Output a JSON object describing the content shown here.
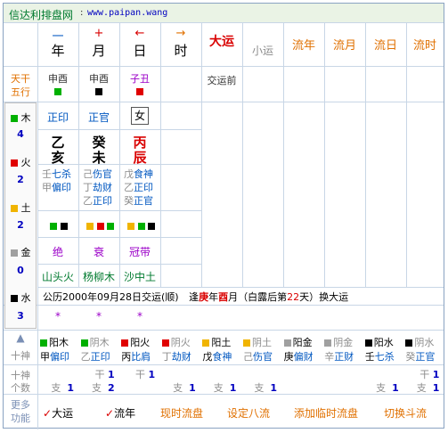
{
  "header": {
    "site_name": "信达利排盘网",
    "site_url": "www.paipan.wang"
  },
  "columns": {
    "year": {
      "top": "一",
      "label": "年"
    },
    "month": {
      "top": "+",
      "label": "月"
    },
    "day": {
      "top": "←",
      "label": "日"
    },
    "hour": {
      "top": "→",
      "label": "时"
    },
    "dayun": "大运",
    "xiaoyun": "小运",
    "liunian": "流年",
    "liuyue": "流月",
    "liuri": "流日",
    "liushi": "流时"
  },
  "left_labels": {
    "tiangan": "天干",
    "wuxing": "五行",
    "shishen": "十神",
    "geshu": "个数",
    "more": "更多",
    "func": "功能"
  },
  "elements": [
    {
      "name": "木",
      "count": "4",
      "color": "#00b000"
    },
    {
      "name": "火",
      "count": "2",
      "color": "#e00000"
    },
    {
      "name": "土",
      "count": "2",
      "color": "#f0b400"
    },
    {
      "name": "金",
      "count": "0",
      "color": "#a0a0a0"
    },
    {
      "name": "水",
      "count": "3",
      "color": "#000000"
    }
  ],
  "pillars": [
    {
      "nayin_top": "申酉",
      "top_color": "#00b000",
      "shishen": "正印",
      "gan": "乙",
      "zhi": "亥",
      "canggan": [
        {
          "gan": "壬",
          "god": "七杀"
        },
        {
          "gan": "甲",
          "god": "偏印"
        }
      ],
      "colors": [
        "#00b000",
        "#000000"
      ],
      "nayin": "山头火",
      "star": "*"
    },
    {
      "nayin_top": "申酉",
      "top_color": "#000000",
      "shishen": "正官",
      "gan": "癸",
      "zhi": "未",
      "canggan": [
        {
          "gan": "己",
          "god": "伤官"
        },
        {
          "gan": "丁",
          "god": "劫财"
        },
        {
          "gan": "乙",
          "god": "正印"
        }
      ],
      "colors": [
        "#f0b400",
        "#e00000",
        "#00b000"
      ],
      "nayin": "杨柳木",
      "star": "*"
    },
    {
      "nayin_top": "子丑",
      "top_color": "#e00000",
      "shishen": "女",
      "gan": "丙",
      "zhi": "辰",
      "canggan": [
        {
          "gan": "戊",
          "god": "食神"
        },
        {
          "gan": "乙",
          "god": "正印"
        },
        {
          "gan": "癸",
          "god": "正官"
        }
      ],
      "colors": [
        "#f0b400",
        "#00b000",
        "#000000"
      ],
      "nayin": "沙中土",
      "star": "*"
    }
  ],
  "changsheng": [
    "绝",
    "衰",
    "冠带"
  ],
  "dayun_note": "交运前",
  "info_line": {
    "prefix": "公历2000年09月28日交运",
    "paren": "(顺)",
    "mid": "逢",
    "gan": "庚",
    "text1": "年",
    "zhi": "酉",
    "text2": "月（白露后第",
    "days": "22",
    "text3": "天）换大运"
  },
  "shishen_row": [
    {
      "sq": "#00b000",
      "gz": "阳木",
      "gan": "甲",
      "god": "偏印",
      "active": true
    },
    {
      "sq": "#00b000",
      "gz": "阴木",
      "gan": "乙",
      "god": "正印",
      "active": false
    },
    {
      "sq": "#e00000",
      "gz": "阳火",
      "gan": "丙",
      "god": "比肩",
      "active": true
    },
    {
      "sq": "#e00000",
      "gz": "阴火",
      "gan": "丁",
      "god": "劫财",
      "active": false
    },
    {
      "sq": "#f0b400",
      "gz": "阳土",
      "gan": "戊",
      "god": "食神",
      "active": true
    },
    {
      "sq": "#f0b400",
      "gz": "阴土",
      "gan": "己",
      "god": "伤官",
      "active": false
    },
    {
      "sq": "#a0a0a0",
      "gz": "阳金",
      "gan": "庚",
      "god": "偏财",
      "active": true
    },
    {
      "sq": "#a0a0a0",
      "gz": "阴金",
      "gan": "辛",
      "god": "正财",
      "active": false
    },
    {
      "sq": "#000000",
      "gz": "阳水",
      "gan": "壬",
      "god": "七杀",
      "active": true
    },
    {
      "sq": "#000000",
      "gz": "阴水",
      "gan": "癸",
      "god": "正官",
      "active": false
    }
  ],
  "count_row": [
    {
      "gan_label": "",
      "gan_val": "",
      "zhi_label": "支",
      "zhi_val": "1"
    },
    {
      "gan_label": "干",
      "gan_val": "1",
      "zhi_label": "支",
      "zhi_val": "2"
    },
    {
      "gan_label": "干",
      "gan_val": "1",
      "zhi_label": "",
      "zhi_val": ""
    },
    {
      "gan_label": "",
      "gan_val": "",
      "zhi_label": "支",
      "zhi_val": "1"
    },
    {
      "gan_label": "",
      "gan_val": "",
      "zhi_label": "支",
      "zhi_val": "1"
    },
    {
      "gan_label": "",
      "gan_val": "",
      "zhi_label": "支",
      "zhi_val": "1"
    },
    {
      "gan_label": "",
      "gan_val": "",
      "zhi_label": "",
      "zhi_val": ""
    },
    {
      "gan_label": "",
      "gan_val": "",
      "zhi_label": "",
      "zhi_val": ""
    },
    {
      "gan_label": "",
      "gan_val": "",
      "zhi_label": "支",
      "zhi_val": "1"
    },
    {
      "gan_label": "干",
      "gan_val": "1",
      "zhi_label": "支",
      "zhi_val": "1"
    }
  ],
  "actions": [
    {
      "label": "大运",
      "check": "✓"
    },
    {
      "label": "流年",
      "check": "✓"
    },
    {
      "label": "现时流盘"
    },
    {
      "label": "设定八流"
    },
    {
      "label": "添加临时流盘"
    },
    {
      "label": "切换斗流"
    }
  ],
  "triangle": "▲"
}
